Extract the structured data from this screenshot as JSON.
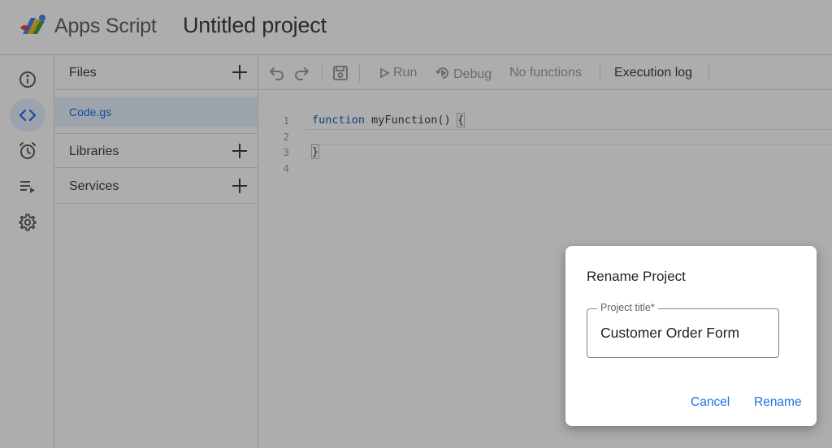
{
  "header": {
    "app_name": "Apps Script",
    "project_title": "Untitled project",
    "logo_icon": "apps-script-logo"
  },
  "rail": {
    "items": [
      {
        "icon": "info-icon",
        "label": "Overview"
      },
      {
        "icon": "code-icon",
        "label": "Editor",
        "active": true
      },
      {
        "icon": "alarm-clock-icon",
        "label": "Triggers"
      },
      {
        "icon": "playlist-play-icon",
        "label": "Executions"
      },
      {
        "icon": "gear-icon",
        "label": "Project Settings"
      }
    ]
  },
  "files_panel": {
    "files_label": "Files",
    "active_file": "Code.gs",
    "libraries_label": "Libraries",
    "services_label": "Services"
  },
  "toolbar": {
    "run_label": "Run",
    "debug_label": "Debug",
    "function_select": "No functions",
    "execution_log_label": "Execution log"
  },
  "editor": {
    "line_numbers": [
      "1",
      "2",
      "3",
      "4"
    ],
    "code": {
      "keyword": "function",
      "signature": " myFunction() ",
      "open_brace": "{",
      "close_brace": "}"
    }
  },
  "dialog": {
    "title": "Rename Project",
    "field_label": "Project title*",
    "field_value": "Customer Order Form",
    "cancel_label": "Cancel",
    "rename_label": "Rename"
  },
  "colors": {
    "accent": "#1a73e8",
    "scrim": "rgba(0,0,0,0.32)",
    "active_bg": "#e8f0fe"
  }
}
